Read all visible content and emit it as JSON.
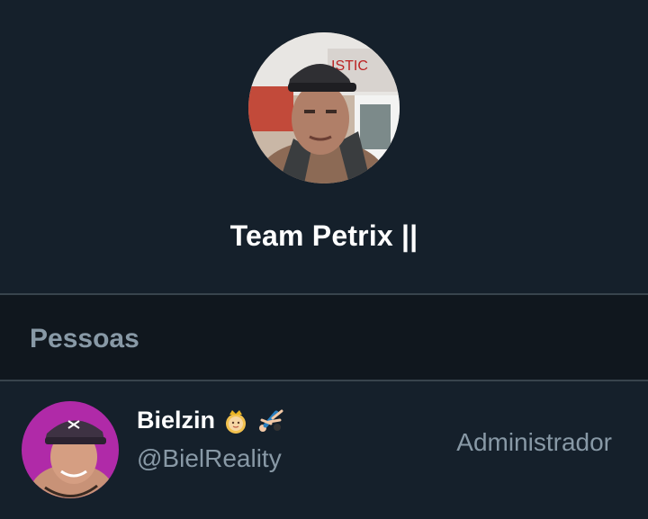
{
  "group": {
    "name": "Team Petrix ||"
  },
  "section": {
    "title": "Pessoas"
  },
  "members": [
    {
      "name": "Bielzin",
      "emojis": [
        "princess-emoji",
        "cartwheel-emoji"
      ],
      "handle": "@BielReality",
      "role": "Administrador"
    }
  ],
  "colors": {
    "background": "#15202b",
    "section_band": "#10171e",
    "divider": "#38444d",
    "primary_text": "#ffffff",
    "secondary_text": "#8899a6"
  }
}
